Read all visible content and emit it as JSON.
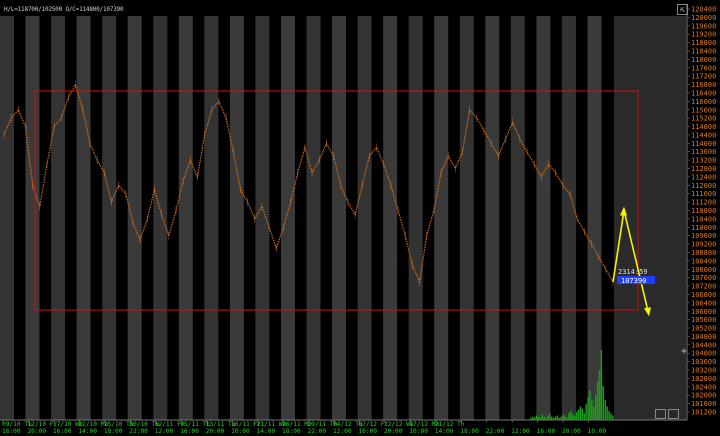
{
  "header": {
    "ohlc_left": "H/L=118700/102500",
    "ohlc_right": "O/C=114800/107390"
  },
  "colors": {
    "price": "#d6731c",
    "volume": "#1a9e1a",
    "selection_box": "#d01010",
    "arrow": "#f5f500",
    "label_bg": "#1f3fff",
    "x_ticks": "#1fd11f",
    "y_ticks": "#e07a1f"
  },
  "annotation": {
    "label_top": "2314:59",
    "label_value": "107390"
  },
  "chart_data": {
    "type": "line",
    "ylim": [
      101200,
      120400
    ],
    "y_ticks": [
      "120400",
      "120000",
      "119600",
      "119200",
      "118800",
      "118400",
      "118000",
      "117600",
      "117200",
      "116800",
      "116400",
      "116000",
      "115600",
      "115200",
      "114800",
      "114400",
      "114000",
      "113600",
      "113200",
      "112800",
      "112400",
      "112000",
      "111600",
      "111200",
      "110800",
      "110400",
      "110000",
      "109600",
      "109200",
      "108800",
      "108400",
      "108000",
      "107600",
      "107200",
      "106800",
      "106400",
      "106000",
      "105600",
      "105200",
      "104800",
      "104400",
      "104000",
      "103600",
      "103200",
      "102800",
      "102400",
      "102000",
      "101600",
      "101200"
    ],
    "x_ticks": [
      {
        "top": "09/10 Tu",
        "bottom": "16:00"
      },
      {
        "top": "12/10 Fr",
        "bottom": "20:00"
      },
      {
        "top": "17/10 We",
        "bottom": "16:00"
      },
      {
        "top": "22/10 Mo",
        "bottom": "14:00"
      },
      {
        "top": "15/10 Th",
        "bottom": "18:00"
      },
      {
        "top": "30/10 Tu",
        "bottom": "22:00"
      },
      {
        "top": "02/11 Fr",
        "bottom": "12:00"
      },
      {
        "top": "05/11 Th",
        "bottom": "16:00"
      },
      {
        "top": "13/11 Tu",
        "bottom": "20:00"
      },
      {
        "top": "16/11 Fr",
        "bottom": "10:00"
      },
      {
        "top": "21/11 We",
        "bottom": "14:00"
      },
      {
        "top": "26/11 Mo",
        "bottom": "18:00"
      },
      {
        "top": "29/11 Th",
        "bottom": "22:00"
      },
      {
        "top": "04/12 Tu",
        "bottom": "12:00"
      },
      {
        "top": "07/12 Fr",
        "bottom": "16:00"
      },
      {
        "top": "12/12 We",
        "bottom": "20:00"
      },
      {
        "top": "17/12 Mo",
        "bottom": "10:00"
      },
      {
        "top": "21/12 Th",
        "bottom": "14:00"
      },
      {
        "top": "",
        "bottom": "18:00"
      },
      {
        "top": "",
        "bottom": "22:00"
      },
      {
        "top": "",
        "bottom": "12:00"
      },
      {
        "top": "",
        "bottom": "16:00"
      },
      {
        "top": "",
        "bottom": "20:00"
      },
      {
        "top": "",
        "bottom": "10:00"
      }
    ],
    "series": [
      {
        "x": [
          0,
          2,
          4,
          6,
          8,
          10,
          12,
          14,
          16,
          18,
          20,
          22,
          24,
          26,
          28,
          30,
          32,
          34,
          36,
          38,
          40,
          42,
          44,
          46,
          48,
          50,
          52,
          54,
          56,
          58,
          60,
          62,
          64,
          66,
          68,
          70,
          72,
          74,
          76,
          78,
          80,
          82,
          84,
          86,
          88,
          90,
          92,
          94,
          96,
          98,
          100,
          102,
          104,
          106,
          108,
          110,
          112,
          114,
          116,
          118,
          120,
          122,
          124,
          126,
          128,
          130,
          132,
          134,
          136,
          138,
          140,
          142,
          144,
          146,
          148,
          150,
          152,
          154,
          156,
          158,
          160,
          162,
          164,
          166,
          168,
          170
        ],
        "values": [
          114400,
          115200,
          115600,
          114800,
          112000,
          111000,
          113000,
          114800,
          115200,
          116200,
          116800,
          115600,
          114000,
          113200,
          112600,
          111200,
          112000,
          111600,
          110200,
          109400,
          110400,
          111800,
          110600,
          109600,
          110800,
          112200,
          113200,
          112400,
          114400,
          115600,
          116000,
          115200,
          113600,
          111800,
          111200,
          110400,
          111000,
          110000,
          109000,
          110000,
          111200,
          112600,
          113800,
          112600,
          113200,
          114000,
          113400,
          112000,
          111200,
          110600,
          112000,
          113400,
          113800,
          113000,
          112000,
          110800,
          109600,
          108200,
          107400,
          109600,
          110800,
          112600,
          113400,
          112800,
          113600,
          115600,
          115200,
          114600,
          114000,
          113400,
          114200,
          115000,
          114200,
          113600,
          113000,
          112400,
          113000,
          112600,
          112000,
          111600,
          110400,
          109800,
          109200,
          108600,
          108000,
          107390
        ]
      }
    ],
    "volume": [
      2,
      3,
      2,
      4,
      3,
      2,
      5,
      3,
      2,
      4,
      6,
      3,
      2,
      3,
      4,
      2,
      3,
      5,
      4,
      2,
      6,
      8,
      5,
      4,
      7,
      9,
      12,
      10,
      6,
      14,
      20,
      26,
      18,
      12,
      22,
      34,
      44,
      62,
      30,
      18,
      12,
      8,
      6,
      4
    ],
    "arrow_points_units": [
      [
        110800,
        0
      ],
      [
        106000,
        1
      ]
    ],
    "grid": false
  }
}
